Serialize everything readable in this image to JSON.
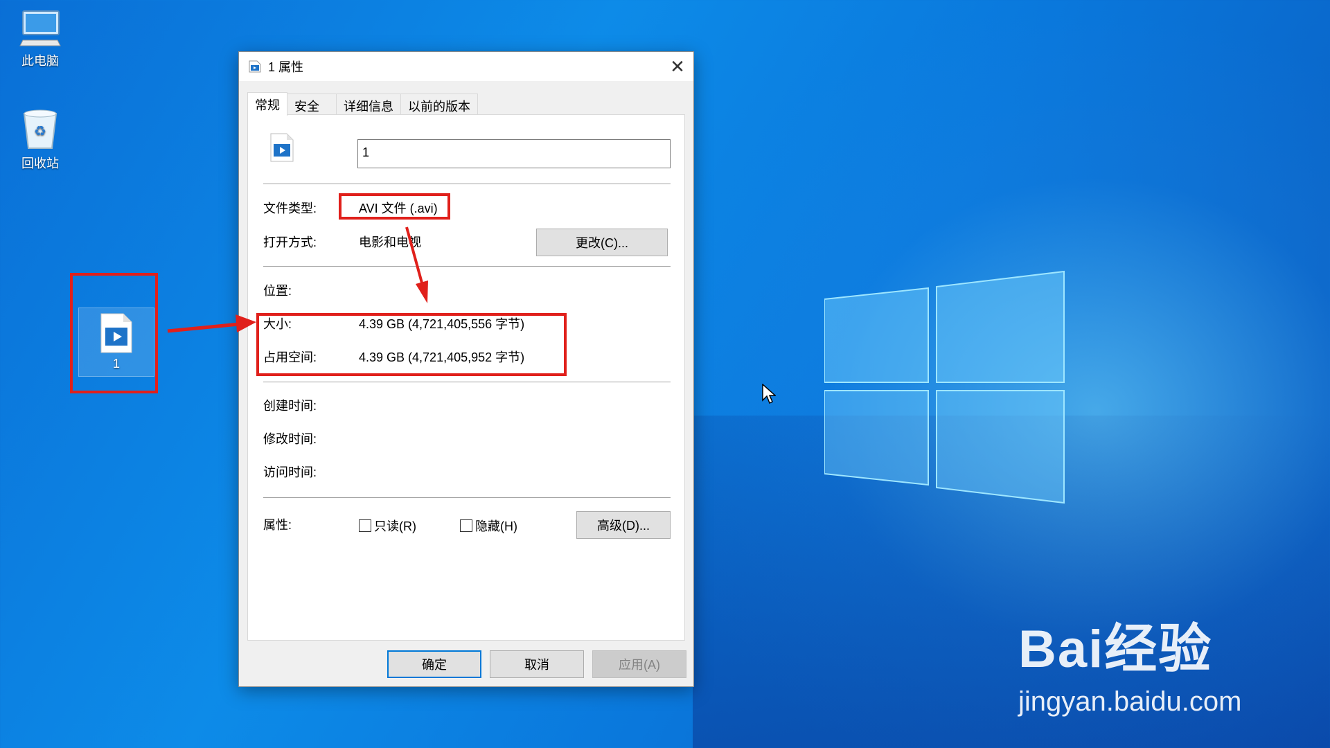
{
  "desktop": {
    "icons": [
      {
        "label": "此电脑",
        "icon": "computer-icon"
      },
      {
        "label": "回收站",
        "icon": "recycle-bin-icon"
      },
      {
        "label": "1",
        "icon": "video-file-icon"
      }
    ]
  },
  "dialog": {
    "title": "1 属性",
    "close_glyph": "✕",
    "tabs": [
      {
        "label": "常规",
        "active": true
      },
      {
        "label": "安全"
      },
      {
        "label": "详细信息"
      },
      {
        "label": "以前的版本"
      }
    ],
    "general": {
      "filename": "1",
      "file_type_label": "文件类型:",
      "file_type_value": "AVI 文件 (.avi)",
      "opens_with_label": "打开方式:",
      "opens_with_value": "电影和电视",
      "change_button": "更改(C)...",
      "location_label": "位置:",
      "size_label": "大小:",
      "size_value": "4.39 GB (4,721,405,556 字节)",
      "size_on_disk_label": "占用空间:",
      "size_on_disk_value": "4.39 GB (4,721,405,952 字节)",
      "created_label": "创建时间:",
      "modified_label": "修改时间:",
      "accessed_label": "访问时间:",
      "attributes_label": "属性:",
      "readonly_label": "只读(R)",
      "hidden_label": "隐藏(H)",
      "advanced_button": "高级(D)..."
    },
    "buttons": {
      "ok": "确定",
      "cancel": "取消",
      "apply": "应用(A)"
    }
  },
  "watermark": {
    "brand": "Bai经验",
    "url": "jingyan.baidu.com"
  },
  "colors": {
    "annotation": "#e0201b",
    "accent": "#0078d7"
  }
}
